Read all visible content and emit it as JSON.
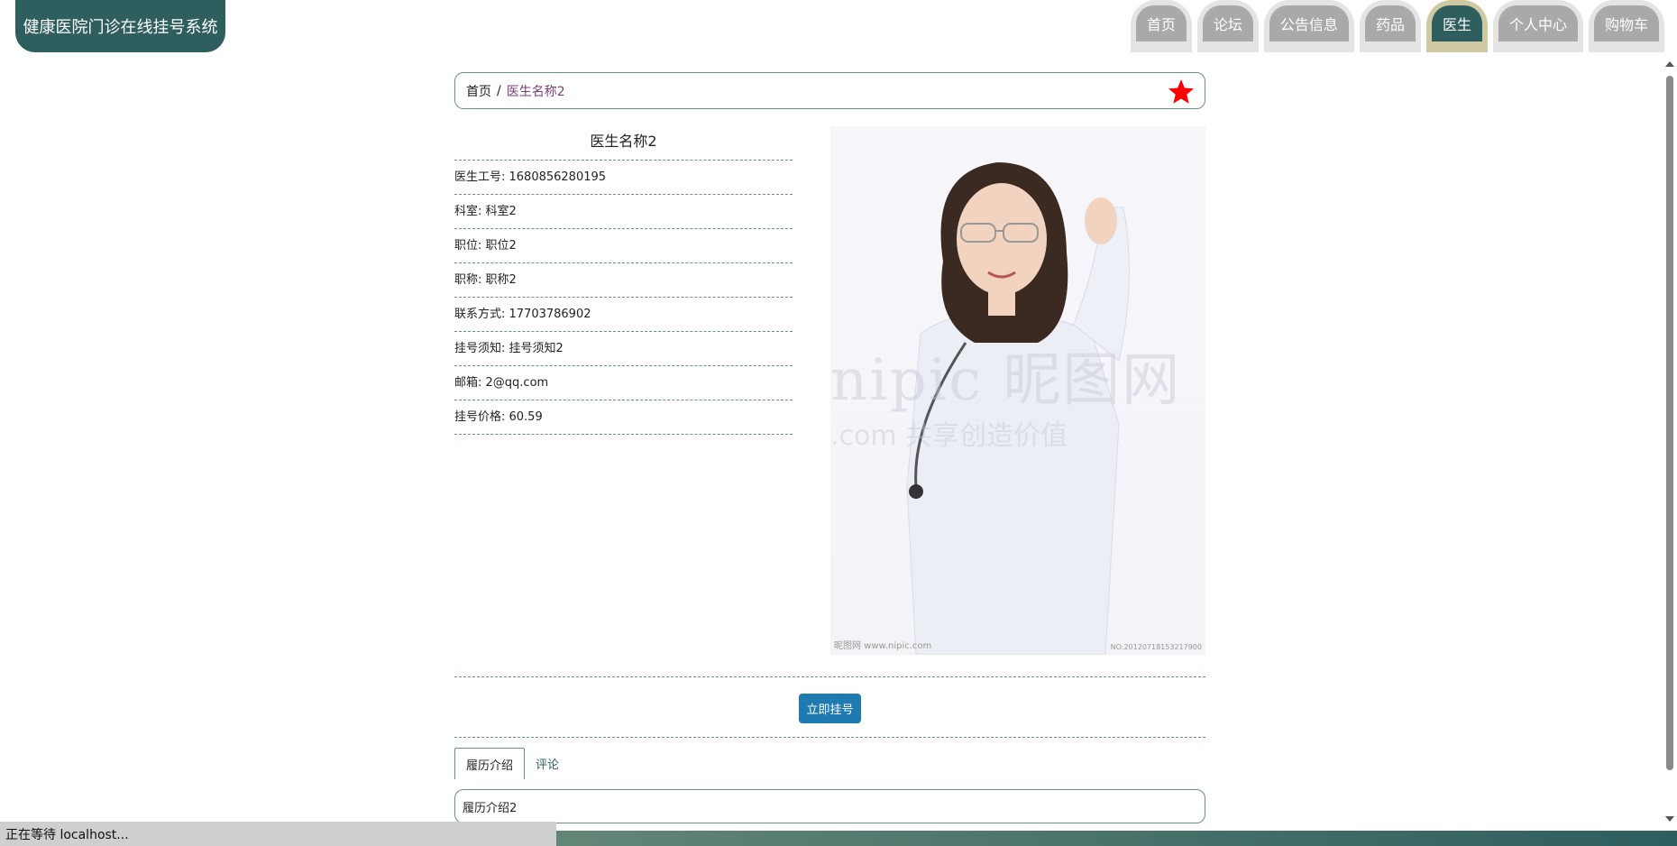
{
  "header": {
    "brand": "健康医院门诊在线挂号系统",
    "nav": [
      {
        "label": "首页",
        "active": false
      },
      {
        "label": "论坛",
        "active": false
      },
      {
        "label": "公告信息",
        "active": false
      },
      {
        "label": "药品",
        "active": false
      },
      {
        "label": "医生",
        "active": true
      },
      {
        "label": "个人中心",
        "active": false
      },
      {
        "label": "购物车",
        "active": false
      }
    ]
  },
  "breadcrumb": {
    "home": "首页",
    "separator": "/",
    "current": "医生名称2",
    "favorite_color": "#ff0000"
  },
  "doctor": {
    "name": "医生名称2",
    "fields": [
      "医生工号: 1680856280195",
      "科室: 科室2",
      "职位: 职位2",
      "职称: 职称2",
      "联系方式: 17703786902",
      "挂号须知: 挂号须知2",
      "邮箱: 2@qq.com",
      "挂号价格: 60.59"
    ],
    "photo": {
      "watermark_main": "nipic 昵图网",
      "watermark_sub": ".com  共享创造价值",
      "footer_left": "昵图网 www.nipic.com",
      "footer_right": "NO:20120718153217900"
    }
  },
  "actions": {
    "book_label": "立即挂号"
  },
  "tabs": [
    {
      "label": "履历介绍",
      "active": true
    },
    {
      "label": "评论",
      "active": false
    }
  ],
  "tab_content": "履历介绍2",
  "status_bar": "正在等待 localhost...",
  "colors": {
    "primary": "#2e5e5e",
    "accent_button": "#1f7ab0",
    "breadcrumb_current": "#7d3c7a"
  }
}
